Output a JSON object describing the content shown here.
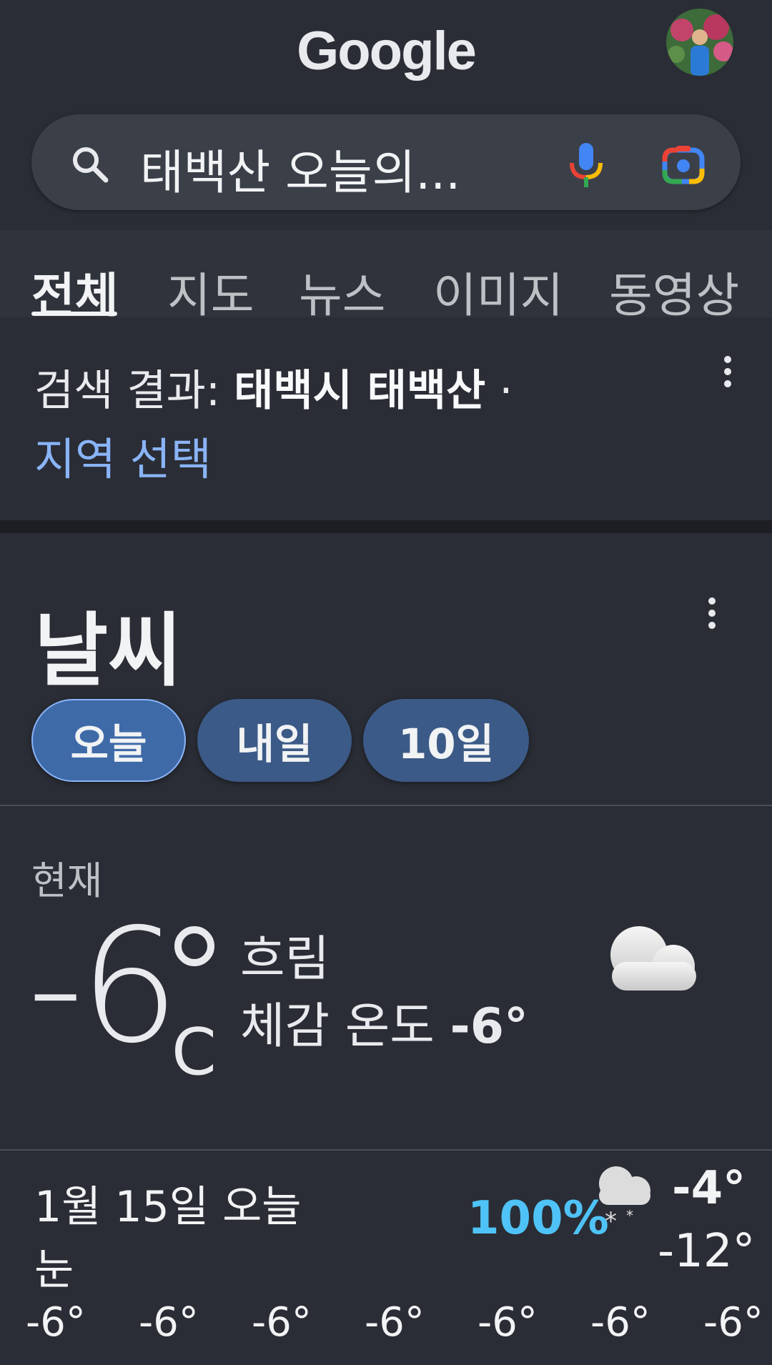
{
  "header": {
    "logo": "Google"
  },
  "search": {
    "query": "태백산 오늘의..."
  },
  "tabs": [
    "전체",
    "지도",
    "뉴스",
    "이미지",
    "동영상"
  ],
  "location": {
    "prefix": "검색 결과: ",
    "place": "태백시 태백산",
    "separator": " ·",
    "change_link": "지역 선택"
  },
  "weather": {
    "title": "날씨",
    "chips": [
      "오늘",
      "내일",
      "10일"
    ],
    "selected_chip": "오늘",
    "now_label": "현재",
    "temperature": "-6",
    "unit": "C",
    "condition": "흐림",
    "feels_like_label": "체감 온도 ",
    "feels_like_value": "-6°",
    "condition_icon": "cloud-icon",
    "day": {
      "label": "1월 15일 오늘",
      "condition": "눈",
      "precip": "100%",
      "icon": "snow-cloud-icon",
      "high": "-4°",
      "low": "-12°"
    },
    "hourly": [
      "-6°",
      "-6°",
      "-6°",
      "-6°",
      "-6°",
      "-6°",
      "-6°"
    ]
  },
  "colors": {
    "background": "#2a2d35",
    "link": "#8ab4f8",
    "precip": "#4fc3f7",
    "chip": "#3c5a87"
  }
}
